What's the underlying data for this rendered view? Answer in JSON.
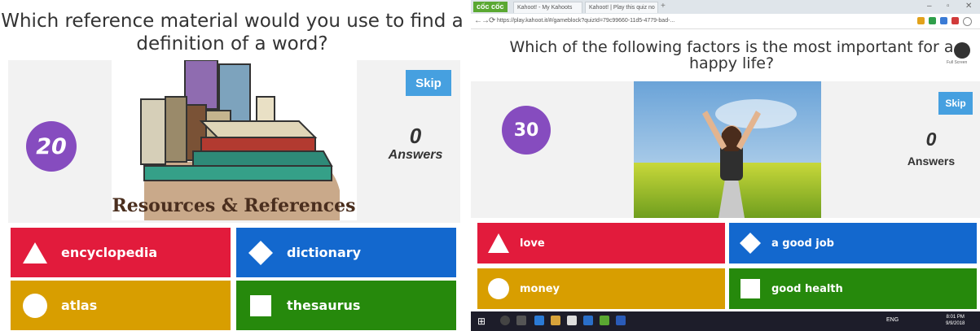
{
  "left": {
    "question": "Which reference material would you use to find a definition of a word?",
    "timer": "20",
    "skip_label": "Skip",
    "answer_count": "0",
    "answers_label": "Answers",
    "image_caption": "Resources & References",
    "answers": [
      {
        "label": "encyclopedia",
        "shape": "triangle-icon",
        "color": "#e21b3c"
      },
      {
        "label": "dictionary",
        "shape": "diamond-icon",
        "color": "#1368ce"
      },
      {
        "label": "atlas",
        "shape": "circle-icon",
        "color": "#d89e00"
      },
      {
        "label": "thesaurus",
        "shape": "square-icon",
        "color": "#26890c"
      }
    ]
  },
  "right": {
    "browser": {
      "logo": "cốc cốc",
      "tabs": [
        "Kahoot! - My Kahoots",
        "Kahoot! | Play this quiz no"
      ],
      "url": "https://play.kahoot.it/#/gameblock?quizId=79c99660-11d5-4779-bad-..."
    },
    "question": "Which of the following factors is the most important for a happy life?",
    "fullscreen_label": "Full Screen",
    "timer": "30",
    "skip_label": "Skip",
    "answer_count": "0",
    "answers_label": "Answers",
    "answers": [
      {
        "label": "love",
        "shape": "triangle-icon",
        "color": "#e21b3c"
      },
      {
        "label": "a good job",
        "shape": "diamond-icon",
        "color": "#1368ce"
      },
      {
        "label": "money",
        "shape": "circle-icon",
        "color": "#d89e00"
      },
      {
        "label": "good health",
        "shape": "square-icon",
        "color": "#26890c"
      }
    ],
    "taskbar": {
      "time": "8:01 PM",
      "date": "9/9/2018",
      "language": "ENG"
    }
  }
}
